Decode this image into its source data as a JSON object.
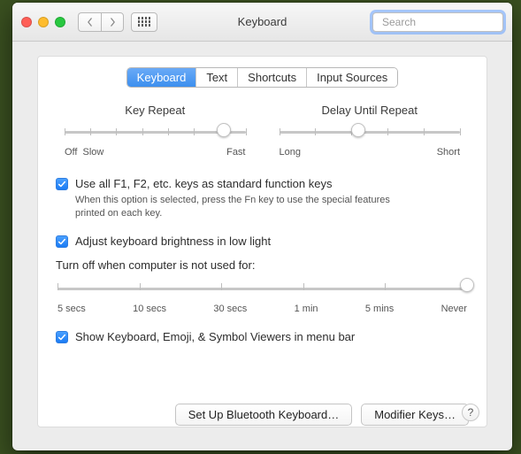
{
  "header": {
    "title": "Keyboard",
    "search_placeholder": "Search"
  },
  "tabs": [
    {
      "label": "Keyboard",
      "active": true
    },
    {
      "label": "Text",
      "active": false
    },
    {
      "label": "Shortcuts",
      "active": false
    },
    {
      "label": "Input Sources",
      "active": false
    }
  ],
  "key_repeat": {
    "title": "Key Repeat",
    "left_label_1": "Off",
    "left_label_2": "Slow",
    "right_label": "Fast",
    "value_percent": 88,
    "ticks": 8
  },
  "delay_repeat": {
    "title": "Delay Until Repeat",
    "left_label": "Long",
    "right_label": "Short",
    "value_percent": 44,
    "ticks": 6
  },
  "fn_keys": {
    "label": "Use all F1, F2, etc. keys as standard function keys",
    "hint": "When this option is selected, press the Fn key to use the special features printed on each key.",
    "checked": true
  },
  "brightness": {
    "label": "Adjust keyboard brightness in low light",
    "checked": true
  },
  "turnoff": {
    "title": "Turn off when computer is not used for:",
    "labels": [
      "5 secs",
      "10 secs",
      "30 secs",
      "1 min",
      "5 mins",
      "Never"
    ],
    "value_percent": 100,
    "ticks": 6
  },
  "show_viewers": {
    "label": "Show Keyboard, Emoji, & Symbol Viewers in menu bar",
    "checked": true
  },
  "buttons": {
    "bluetooth": "Set Up Bluetooth Keyboard…",
    "modifier": "Modifier Keys…"
  },
  "help": "?"
}
